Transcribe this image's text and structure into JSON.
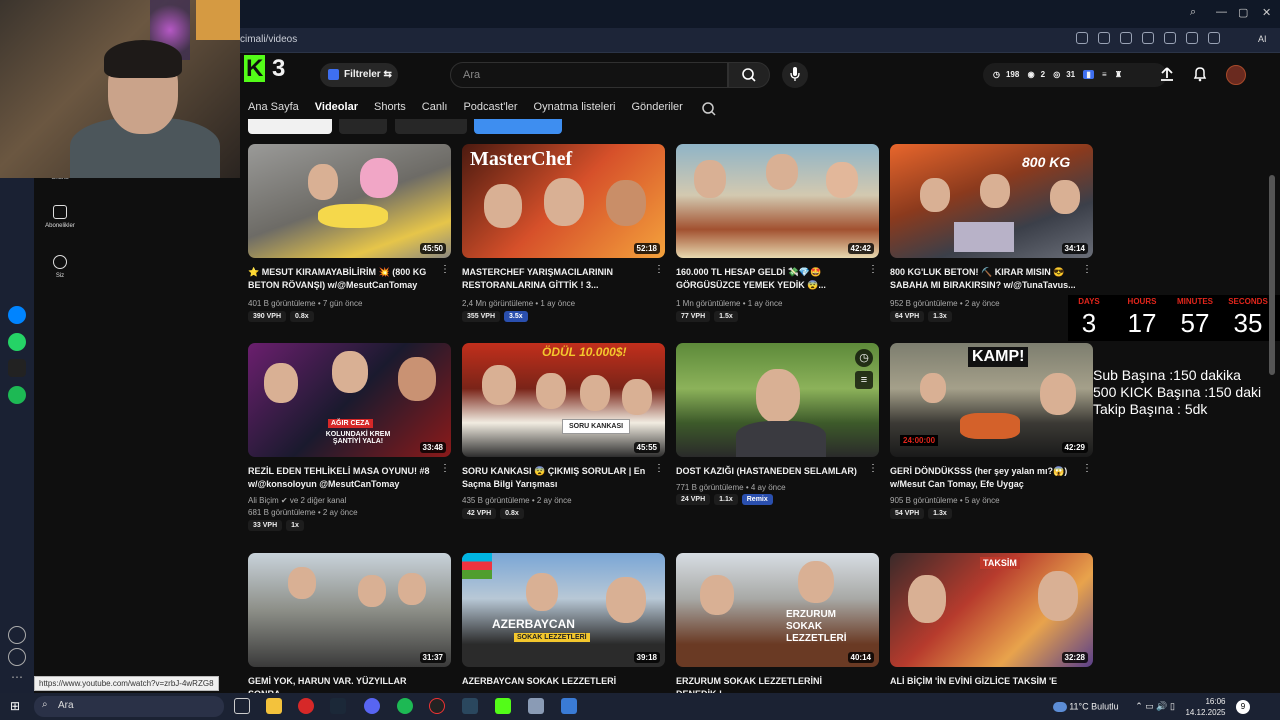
{
  "browser": {
    "url": "cimali/videos",
    "ai_label": "AI"
  },
  "webcam": {
    "label": "webcam-overlay"
  },
  "sidebar": {
    "items": [
      {
        "label": "Shorts"
      },
      {
        "label": "Abonelikler"
      },
      {
        "label": "Siz"
      }
    ]
  },
  "header": {
    "logo_letter": "K",
    "logo_num": "3",
    "filters_label": "Filtreler",
    "search_placeholder": "Ara",
    "stats": {
      "clock": "198",
      "plays": "2",
      "views": "31"
    }
  },
  "tabs": [
    {
      "label": "Ana Sayfa",
      "active": false
    },
    {
      "label": "Videolar",
      "active": true
    },
    {
      "label": "Shorts",
      "active": false
    },
    {
      "label": "Canlı",
      "active": false
    },
    {
      "label": "Podcast'ler",
      "active": false
    },
    {
      "label": "Oynatma listeleri",
      "active": false
    },
    {
      "label": "Gönderiler",
      "active": false
    }
  ],
  "videos": [
    {
      "title": "⭐ MESUT KIRAMAYABİLİRİM 💥 (800 KG BETON RÖVANŞI) w/@MesutCanTomay",
      "meta1": "401 B görüntüleme • 7 gün önce",
      "duration": "45:50",
      "vph": "390 VPH",
      "mult": "0.8x"
    },
    {
      "title": "MASTERCHEF YARIŞMACILARININ RESTORANLARINA GİTTİK ! 3...",
      "meta1": "2,4 Mn görüntüleme • 1 ay önce",
      "duration": "52:18",
      "vph": "355 VPH",
      "mult": "3.5x"
    },
    {
      "title": "160.000 TL HESAP GELDİ 💸💎🤩 GÖRGÜSÜZCE YEMEK YEDİK 😨...",
      "meta1": "1 Mn görüntüleme • 1 ay önce",
      "duration": "42:42",
      "vph": "77 VPH",
      "mult": "1.5x"
    },
    {
      "title": "800 KG'LUK BETON! ⛏️ KIRAR MISIN 😎 SABAHA MI BIRAKIRSIN? w/@TunaTavus...",
      "meta1": "952 B görüntüleme • 2 ay önce",
      "duration": "34:14",
      "vph": "64 VPH",
      "mult": "1.3x"
    },
    {
      "title": "REZİL EDEN TEHLİKELİ MASA OYUNU! #8 w/@konsoloyun @MesutCanTomay",
      "meta1": "Ali Biçim ✔ ve 2 diğer kanal",
      "meta2": "681 B görüntüleme • 2 ay önce",
      "duration": "33:48",
      "vph": "33 VPH",
      "mult": "1x"
    },
    {
      "title": "SORU KANKASI 😨 ÇIKMIŞ SORULAR | En Saçma Bilgi Yarışması",
      "meta1": "435 B görüntüleme • 2 ay önce",
      "duration": "45:55",
      "vph": "42 VPH",
      "mult": "0.8x"
    },
    {
      "title": "DOST KAZIĞI (HASTANEDEN SELAMLAR)",
      "meta1": "771 B görüntüleme • 4 ay önce",
      "duration": "",
      "vph": "24 VPH",
      "mult": "1.1x",
      "remix": "Remix"
    },
    {
      "title": "GERİ DÖNDÜKSSS (her şey yalan mı?😱) w/Mesut Can Tomay, Efe Uygaç",
      "meta1": "905 B görüntüleme • 5 ay önce",
      "duration": "42:29",
      "vph": "54 VPH",
      "mult": "1.3x"
    },
    {
      "title": "GEMİ YOK, HARUN VAR. YÜZYILLAR SONRA",
      "duration": "31:37"
    },
    {
      "title": "AZERBAYCAN SOKAK LEZZETLERİ",
      "duration": "39:18"
    },
    {
      "title": "ERZURUM SOKAK LEZZETLERİNİ DENEDİK !",
      "duration": "40:14"
    },
    {
      "title": "ALİ BİÇİM 'İN EVİNİ GİZLİCE TAKSİM 'E",
      "duration": "32:28"
    }
  ],
  "thumb_text": {
    "masterchef": "MasterChef",
    "kg": "800 KG",
    "acir": "AĞIR CEZA",
    "kolundaki": "KOLUNDAKİ KREM ŞANTİYİ YALA!",
    "odul": "ÖDÜL 10.000$!",
    "soru": "SORU KANKASI",
    "kamp": "KAMP!",
    "timer": "24:00:00",
    "azer": "AZERBAYCAN",
    "sokak": "SOKAK LEZZETLERİ",
    "erzurum": "ERZURUM SOKAK LEZZETLERİ",
    "taksim": "TAKSİM"
  },
  "countdown": {
    "days_label": "DAYS",
    "days": "3",
    "hours_label": "HOURS",
    "hours": "17",
    "minutes_label": "MINUTES",
    "minutes": "57",
    "seconds_label": "SECONDS",
    "seconds": "35"
  },
  "sub_info": {
    "line1": "Sub Başına :150 dakika",
    "line2": "500 KICK Başına :150 daki",
    "line3": "Takip Başına : 5dk"
  },
  "status_url": "https://www.youtube.com/watch?v=zrbJ-4wRZG8",
  "taskbar": {
    "search": "Ara",
    "weather": "11°C  Bulutlu",
    "time": "16:06",
    "date": "14.12.2025",
    "notif": "9"
  },
  "colors": {
    "kick_green": "#53fc18",
    "countdown_red": "#e1251b",
    "badge_blue": "#2a4fae"
  }
}
